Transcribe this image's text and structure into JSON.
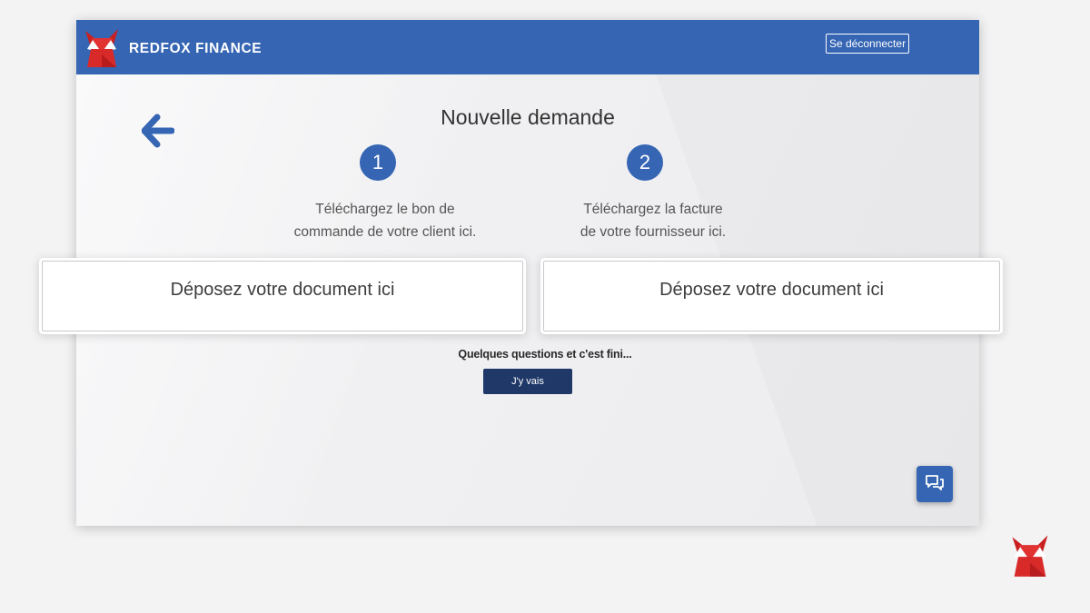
{
  "header": {
    "brand": "REDFOX FINANCE",
    "logout_label": "Se déconnecter",
    "background_color": "#3565b3"
  },
  "main": {
    "title": "Nouvelle demande",
    "back_icon": "back-arrow-icon",
    "steps": [
      {
        "number": "1",
        "text_line1": "Téléchargez le bon de",
        "text_line2": "commande de votre client ici."
      },
      {
        "number": "2",
        "text_line1": "Téléchargez la facture",
        "text_line2": "de votre fournisseur ici."
      }
    ],
    "dropzones": [
      {
        "label": "Déposez votre document ici"
      },
      {
        "label": "Déposez votre document ici"
      }
    ],
    "questions_text": "Quelques questions et c'est fini...",
    "go_button_label": "J'y vais"
  },
  "chat": {
    "icon": "chat-icon"
  },
  "colors": {
    "accent": "#3565b3",
    "dark_button": "#1f3868",
    "logo_red": "#d92a2a"
  }
}
